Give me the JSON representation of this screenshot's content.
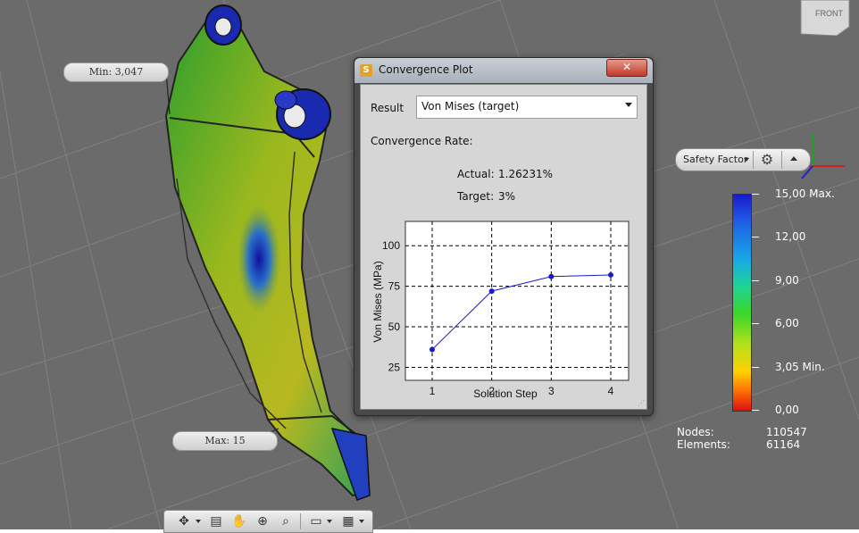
{
  "viewport": {
    "min_callout": "Min: 3,047",
    "max_callout": "Max: 15",
    "viewcube_label": "FRONT"
  },
  "dialog": {
    "title": "Convergence Plot",
    "close_label": "✕",
    "result_label": "Result",
    "result_value": "Von Mises (target)",
    "convergence_rate_label": "Convergence Rate:",
    "actual_label": "Actual:",
    "actual_value": "1.26231%",
    "target_label": "Target:",
    "target_value": "3%"
  },
  "chart_data": {
    "type": "line",
    "xlabel": "Solution Step",
    "ylabel": "Von Mises (MPa)",
    "x": [
      1,
      2,
      3,
      4
    ],
    "series": [
      {
        "values": [
          36,
          72,
          81,
          82
        ],
        "color": "#1a1acc"
      }
    ],
    "xlim": [
      0.55,
      4.3
    ],
    "ylim": [
      17,
      115
    ],
    "xticks": [
      1,
      2,
      3,
      4
    ],
    "yticks": [
      25,
      50,
      75,
      100
    ],
    "grid": true
  },
  "safety_factor_toolbar": {
    "label": "Safety Factor",
    "gear_icon": "gear-icon",
    "collapse_icon": "collapse-icon"
  },
  "legend": {
    "labels": [
      "15,00 Max.",
      "12,00",
      "9,00",
      "6,00",
      "3,05 Min.",
      "0,00"
    ]
  },
  "stats": {
    "nodes_label": "Nodes:",
    "nodes_value": "110547",
    "elements_label": "Elements:",
    "elements_value": "61164"
  },
  "bottom_toolbar": {
    "icons": [
      "pan-orbit-icon",
      "look-at-icon",
      "pan-icon",
      "zoom-icon",
      "zoom-window-icon",
      "display-icon",
      "grid-icon"
    ]
  },
  "colors": {
    "background": "#6b6b6b",
    "accent_blue": "#1a1acc"
  }
}
